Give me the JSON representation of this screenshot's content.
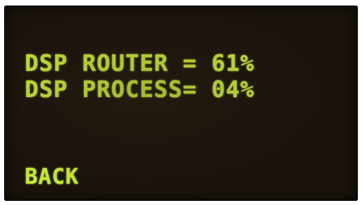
{
  "display": {
    "lines": [
      "DSP ROUTER = 61%",
      "DSP PROCESS= 04%"
    ],
    "back_label": "BACK",
    "text_color": "#c8e83a",
    "background_color": "#1a130c"
  }
}
